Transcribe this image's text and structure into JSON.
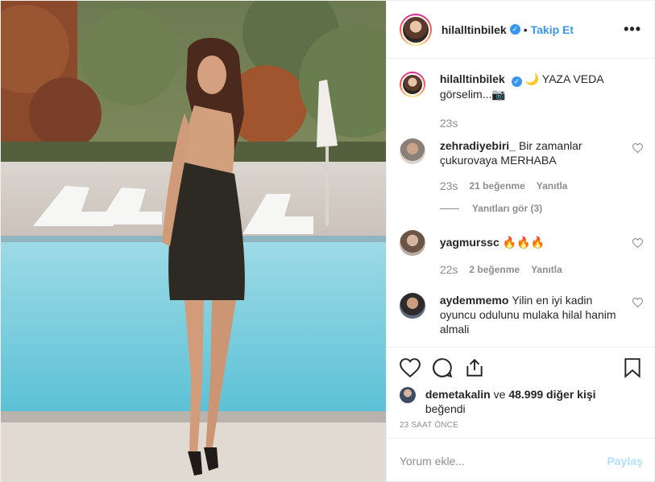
{
  "post": {
    "username": "hilalltinbilek",
    "verified_icon": "verified-badge-icon",
    "dot": "•",
    "follow_label": "Takip Et",
    "more_label": "•••"
  },
  "caption": {
    "username": "hilalltinbilek",
    "text": "🌙 YAZA VEDA görselim...📷",
    "time": "23s"
  },
  "comments": [
    {
      "username": "zehradiyebiri_",
      "text": "Bir zamanlar çukurovaya MERHABA",
      "time": "23s",
      "likes": "21 beğenme",
      "reply": "Yanıtla",
      "view_replies": "Yanıtları gör (3)"
    },
    {
      "username": "yagmurssc",
      "text": "🔥🔥🔥",
      "time": "22s",
      "likes": "2 beğenme",
      "reply": "Yanıtla"
    },
    {
      "username": "aydemmemo",
      "text": "Yilin en iyi kadin oyuncu odulunu mulaka hilal hanim almali"
    }
  ],
  "likes": {
    "username": "demetakalin",
    "rest": "ve",
    "count": "48.999 diğer kişi",
    "tail": "beğendi"
  },
  "timestamp": "23 SAAT ÖNCE",
  "add_comment": {
    "placeholder": "Yorum ekle...",
    "share_label": "Paylaş"
  },
  "colors": {
    "link": "#3897f0",
    "muted": "#8e8e8e",
    "share_disabled": "#b2dffc"
  }
}
